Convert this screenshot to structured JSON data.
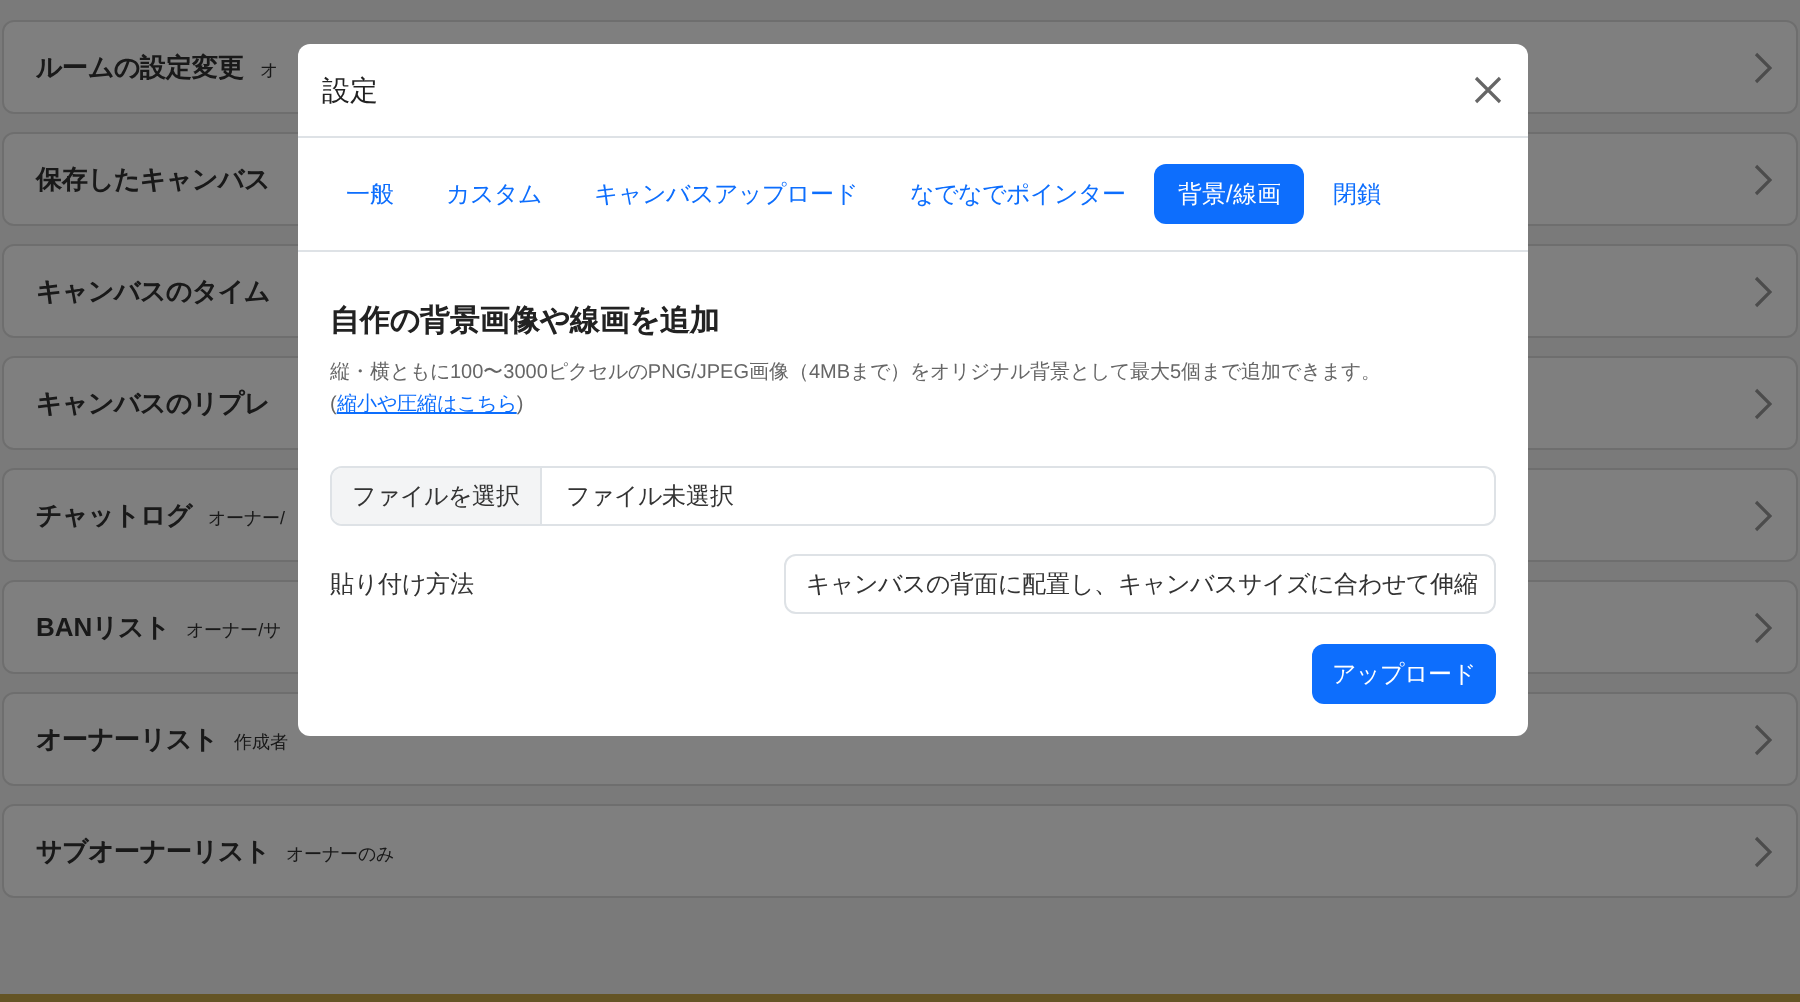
{
  "menu_items": [
    {
      "label": "ルームの設定変更",
      "note": "オ"
    },
    {
      "label": "保存したキャンバス"
    },
    {
      "label": "キャンバスのタイム"
    },
    {
      "label": "キャンバスのリプレ"
    },
    {
      "label": "チャットログ",
      "note": "オーナー/"
    },
    {
      "label": "BANリスト",
      "note": "オーナー/サ"
    },
    {
      "label": "オーナーリスト",
      "note": "作成者"
    },
    {
      "label": "サブオーナーリスト",
      "note": "オーナーのみ"
    }
  ],
  "dialog": {
    "title": "設定",
    "tabs": [
      {
        "label": "一般",
        "selected": false
      },
      {
        "label": "カスタム",
        "selected": false
      },
      {
        "label": "キャンバスアップロード",
        "selected": false
      },
      {
        "label": "なでなでポインター",
        "selected": false
      },
      {
        "label": "背景/線画",
        "selected": true
      },
      {
        "label": "閉鎖",
        "selected": false
      }
    ],
    "heading": "自作の背景画像や線画を追加",
    "description": "縦・横ともに100〜3000ピクセルのPNG/JPEG画像（4MBまで）をオリジナル背景として最大5個まで追加できます。 (",
    "link": "縮小や圧縮はこちら",
    "description_end": ")",
    "file_button": "ファイルを選択",
    "file_status": "ファイル未選択",
    "paste_label": "貼り付け方法",
    "paste_value": "キャンバスの背面に配置し、キャンバスサイズに合わせて伸縮",
    "upload_button": "アップロード"
  }
}
